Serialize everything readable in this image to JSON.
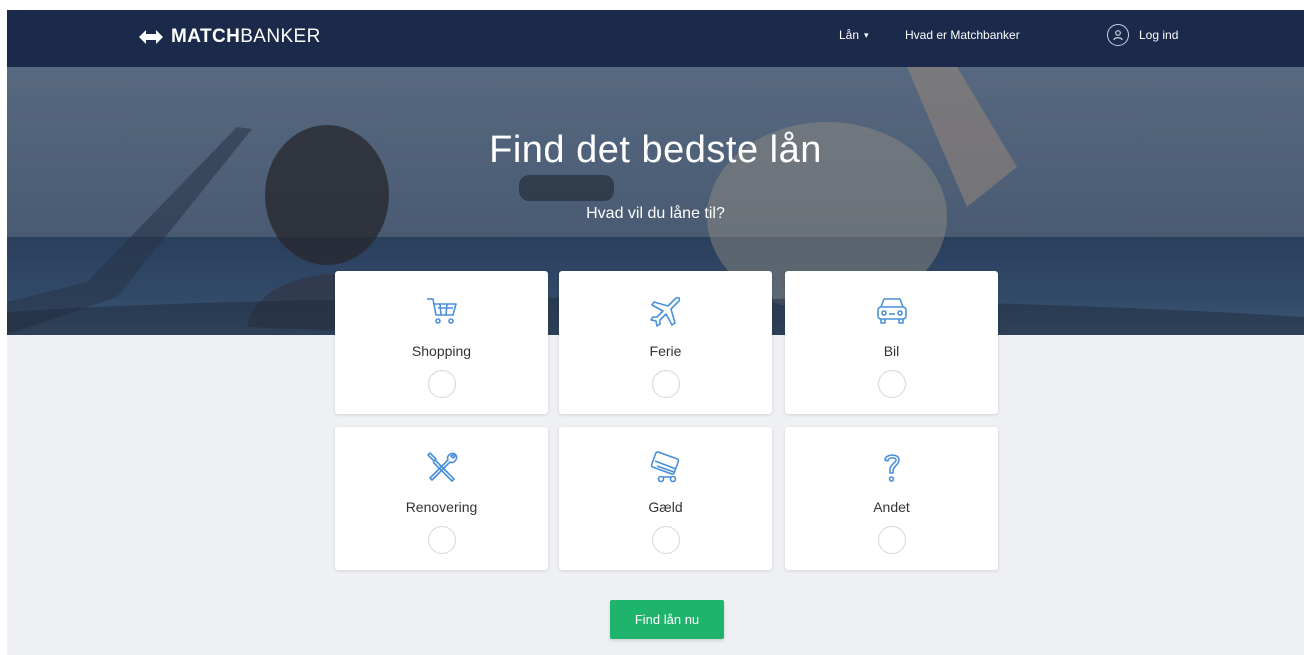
{
  "nav": {
    "logo_bold": "MATCH",
    "logo_light": "BANKER",
    "menu_loans": "Lån",
    "menu_about": "Hvad er Matchbanker",
    "login": "Log ind"
  },
  "hero": {
    "title": "Find det bedste lån",
    "subtitle": "Hvad vil du låne til?"
  },
  "options": [
    {
      "label": "Shopping",
      "icon": "shopping-cart-icon",
      "selected": false
    },
    {
      "label": "Ferie",
      "icon": "airplane-icon",
      "selected": false
    },
    {
      "label": "Bil",
      "icon": "car-icon",
      "selected": false
    },
    {
      "label": "Renovering",
      "icon": "tools-icon",
      "selected": false
    },
    {
      "label": "Gæld",
      "icon": "debt-icon",
      "selected": false
    },
    {
      "label": "Andet",
      "icon": "question-mark-icon",
      "selected": false
    }
  ],
  "cta": {
    "label": "Find lån nu"
  },
  "colors": {
    "nav_bg": "#1b2a4a",
    "page_bg": "#eef0f4",
    "icon_blue": "#4a90d9",
    "cta_green": "#1fb46b"
  }
}
